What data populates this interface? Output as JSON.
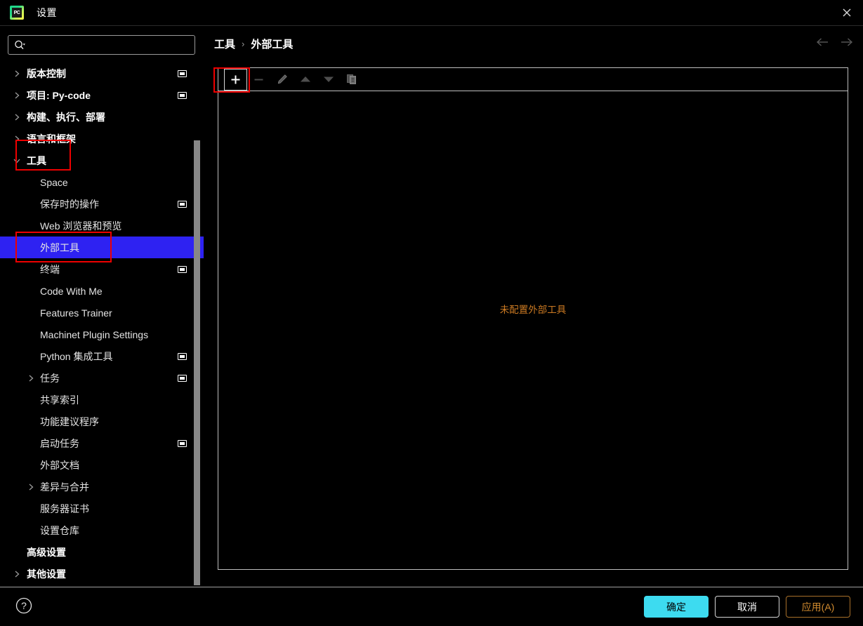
{
  "window": {
    "title": "设置",
    "app_icon": "pycharm-icon",
    "app_icon_text": "PC",
    "close_icon": "close-icon"
  },
  "search": {
    "value": "",
    "placeholder": "",
    "icon": "search-icon"
  },
  "sidebar": {
    "items": [
      {
        "label": "版本控制",
        "level": 1,
        "arrow": "chevron-right",
        "project_icon": true,
        "selected": false
      },
      {
        "label": "项目: Py-code",
        "level": 1,
        "arrow": "chevron-right",
        "project_icon": true,
        "selected": false
      },
      {
        "label": "构建、执行、部署",
        "level": 1,
        "arrow": "chevron-right",
        "project_icon": false,
        "selected": false
      },
      {
        "label": "语言和框架",
        "level": 1,
        "arrow": "chevron-right",
        "project_icon": false,
        "selected": false
      },
      {
        "label": "工具",
        "level": 1,
        "arrow": "chevron-down",
        "project_icon": false,
        "selected": false
      },
      {
        "label": "Space",
        "level": 2,
        "arrow": "none",
        "project_icon": false,
        "selected": false
      },
      {
        "label": "保存时的操作",
        "level": 2,
        "arrow": "none",
        "project_icon": true,
        "selected": false
      },
      {
        "label": "Web 浏览器和预览",
        "level": 2,
        "arrow": "none",
        "project_icon": false,
        "selected": false
      },
      {
        "label": "外部工具",
        "level": 2,
        "arrow": "none",
        "project_icon": false,
        "selected": true
      },
      {
        "label": "终端",
        "level": 2,
        "arrow": "none",
        "project_icon": true,
        "selected": false
      },
      {
        "label": "Code With Me",
        "level": 2,
        "arrow": "none",
        "project_icon": false,
        "selected": false
      },
      {
        "label": "Features Trainer",
        "level": 2,
        "arrow": "none",
        "project_icon": false,
        "selected": false
      },
      {
        "label": "Machinet Plugin Settings",
        "level": 2,
        "arrow": "none",
        "project_icon": false,
        "selected": false
      },
      {
        "label": "Python 集成工具",
        "level": 2,
        "arrow": "none",
        "project_icon": true,
        "selected": false
      },
      {
        "label": "任务",
        "level": 2,
        "arrow": "chevron-right",
        "project_icon": true,
        "selected": false
      },
      {
        "label": "共享索引",
        "level": 2,
        "arrow": "none",
        "project_icon": false,
        "selected": false
      },
      {
        "label": "功能建议程序",
        "level": 2,
        "arrow": "none",
        "project_icon": false,
        "selected": false
      },
      {
        "label": "启动任务",
        "level": 2,
        "arrow": "none",
        "project_icon": true,
        "selected": false
      },
      {
        "label": "外部文档",
        "level": 2,
        "arrow": "none",
        "project_icon": false,
        "selected": false
      },
      {
        "label": "差异与合并",
        "level": 2,
        "arrow": "chevron-right",
        "project_icon": false,
        "selected": false
      },
      {
        "label": "服务器证书",
        "level": 2,
        "arrow": "none",
        "project_icon": false,
        "selected": false
      },
      {
        "label": "设置仓库",
        "level": 2,
        "arrow": "none",
        "project_icon": false,
        "selected": false
      },
      {
        "label": "高级设置",
        "level": 1,
        "arrow": "none",
        "project_icon": false,
        "selected": false
      },
      {
        "label": "其他设置",
        "level": 1,
        "arrow": "chevron-right",
        "project_icon": false,
        "selected": false
      }
    ]
  },
  "main": {
    "breadcrumb": {
      "parent": "工具",
      "separator": "›",
      "current": "外部工具"
    },
    "nav": {
      "back_icon": "arrow-left-icon",
      "forward_icon": "arrow-right-icon"
    },
    "toolbar": {
      "buttons": [
        {
          "name": "add-button",
          "icon": "plus-icon",
          "enabled": true,
          "highlighted": true
        },
        {
          "name": "remove-button",
          "icon": "minus-icon",
          "enabled": false,
          "highlighted": false
        },
        {
          "name": "edit-button",
          "icon": "pencil-icon",
          "enabled": false,
          "highlighted": false
        },
        {
          "name": "move-up-button",
          "icon": "arrow-up-icon",
          "enabled": false,
          "highlighted": false
        },
        {
          "name": "move-down-button",
          "icon": "arrow-down-icon",
          "enabled": false,
          "highlighted": false
        },
        {
          "name": "copy-button",
          "icon": "copy-icon",
          "enabled": false,
          "highlighted": false
        }
      ]
    },
    "empty_message": "未配置外部工具",
    "empty_message_color": "#cc7a22"
  },
  "footer": {
    "help_icon": "help-circle-icon",
    "ok_label": "确定",
    "cancel_label": "取消",
    "apply_label": "应用(A)",
    "ok_color": "#3ddbf0",
    "apply_color": "#d08a2e"
  },
  "annotations": {
    "color": "#ee0000",
    "boxes": [
      "tools-tree-item",
      "external-tools-tree-item",
      "add-toolbar-button"
    ]
  }
}
